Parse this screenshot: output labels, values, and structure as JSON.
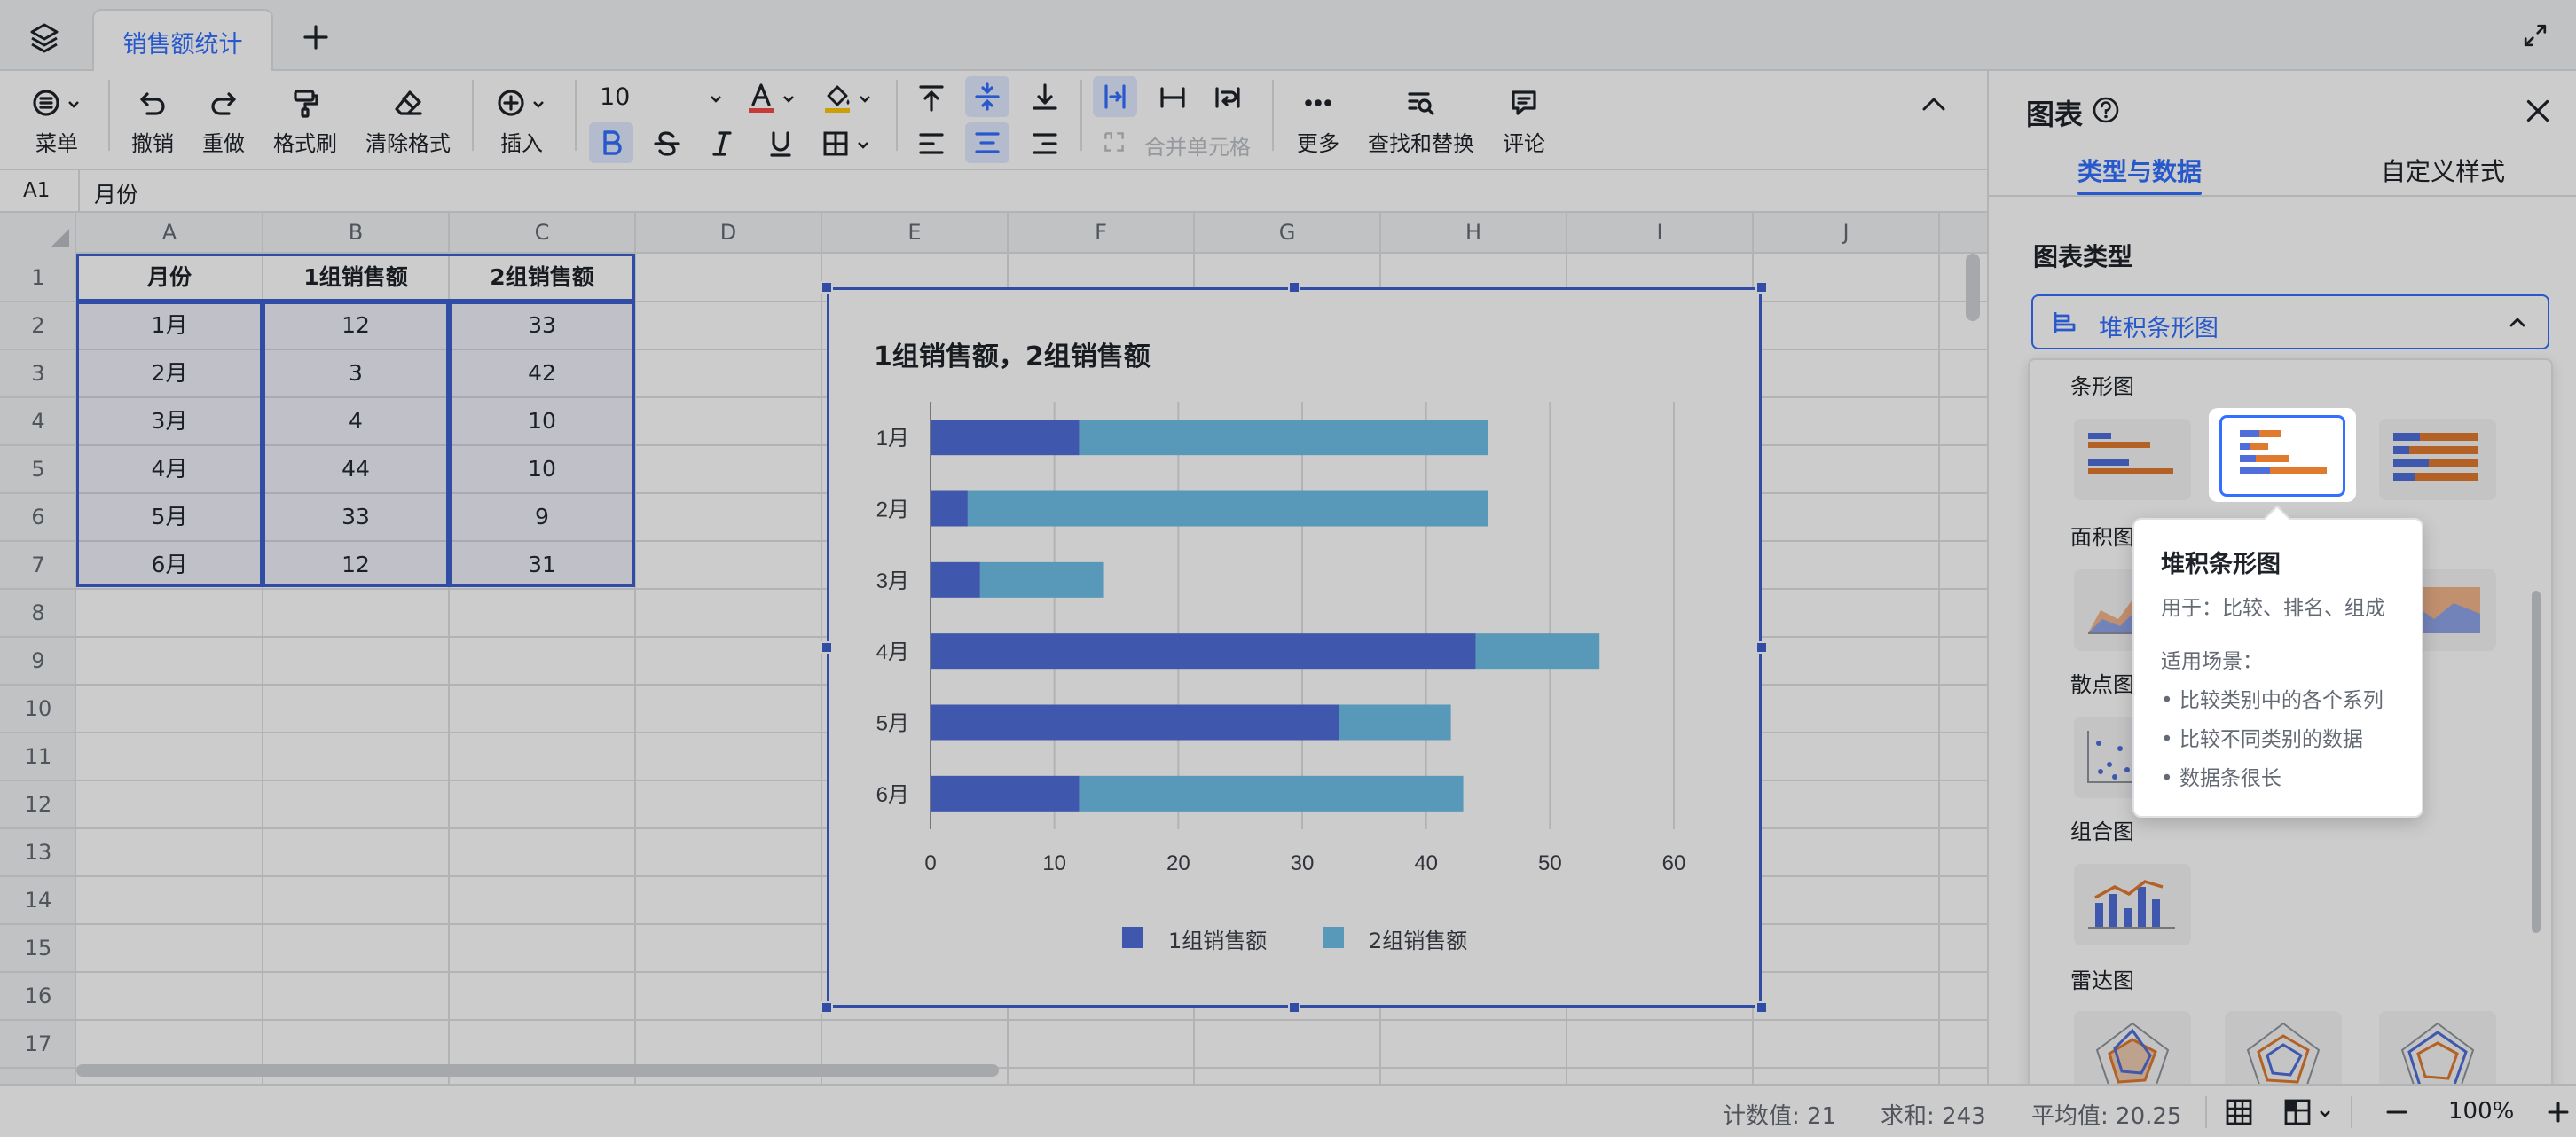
{
  "tab": {
    "name": "销售额统计"
  },
  "toolbar": {
    "menu": "菜单",
    "undo": "撤销",
    "redo": "重做",
    "format_painter": "格式刷",
    "clear_format": "清除格式",
    "insert": "插入",
    "font_size": "10",
    "merge_cells": "合并单元格",
    "more": "更多",
    "find_replace": "查找和替换",
    "comment": "评论"
  },
  "formula": {
    "cell_ref": "A1",
    "content": "月份"
  },
  "columns": [
    "A",
    "B",
    "C",
    "D",
    "E",
    "F",
    "G",
    "H",
    "I",
    "J"
  ],
  "rows": [
    "1",
    "2",
    "3",
    "4",
    "5",
    "6",
    "7",
    "8",
    "9",
    "10",
    "11",
    "12",
    "13",
    "14",
    "15",
    "16",
    "17"
  ],
  "table": {
    "headers": [
      "月份",
      "1组销售额",
      "2组销售额"
    ],
    "rows": [
      [
        "1月",
        "12",
        "33"
      ],
      [
        "2月",
        "3",
        "42"
      ],
      [
        "3月",
        "4",
        "10"
      ],
      [
        "4月",
        "44",
        "10"
      ],
      [
        "5月",
        "33",
        "9"
      ],
      [
        "6月",
        "12",
        "31"
      ]
    ]
  },
  "chart_data": {
    "type": "bar",
    "orientation": "horizontal",
    "stacked": true,
    "title": "1组销售额，2组销售额",
    "categories": [
      "1月",
      "2月",
      "3月",
      "4月",
      "5月",
      "6月"
    ],
    "series": [
      {
        "name": "1组销售额",
        "values": [
          12,
          3,
          4,
          44,
          33,
          12
        ],
        "color": "#4f6ed9"
      },
      {
        "name": "2组销售额",
        "values": [
          33,
          42,
          10,
          10,
          9,
          31
        ],
        "color": "#6fbfe6"
      }
    ],
    "xlim": [
      0,
      60
    ],
    "xticks": [
      "0",
      "10",
      "20",
      "30",
      "40",
      "50",
      "60"
    ],
    "grid": true,
    "legend": "bottom"
  },
  "panel": {
    "title": "图表",
    "tabs": [
      "类型与数据",
      "自定义样式"
    ],
    "section": "图表类型",
    "selected_type": "堆积条形图",
    "categories": [
      "条形图",
      "面积图",
      "散点图",
      "组合图",
      "雷达图"
    ]
  },
  "tooltip": {
    "title": "堆积条形图",
    "usage": "用于：比较、排名、组成",
    "scene_title": "适用场景：",
    "items": [
      "比较类别中的各个系列",
      "比较不同类别的数据",
      "数据条很长"
    ]
  },
  "status": {
    "count": "计数值: 21",
    "sum": "求和: 243",
    "avg": "平均值: 20.25",
    "zoom": "100%"
  },
  "colors": {
    "accent": "#3370ff",
    "series1": "#4f6ed9",
    "series2": "#6fbfe6",
    "selection": "#3c5fcf"
  }
}
